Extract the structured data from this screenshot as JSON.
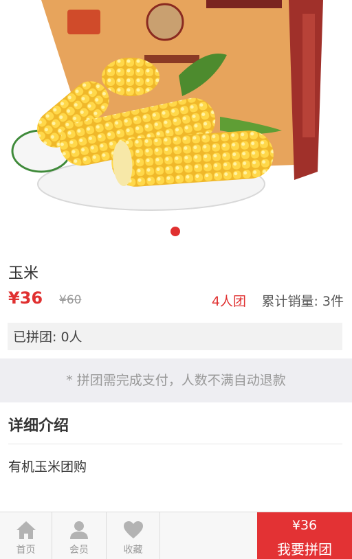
{
  "product": {
    "image_alt": "玉米",
    "slides_total": 1,
    "current_slide": 1,
    "title": "玉米",
    "price": "¥36",
    "original_price": "¥60",
    "group_size": "4人团",
    "sold_label": "累计销量: 3件"
  },
  "joined_label": "已拼团: 0人",
  "notice": "* 拼团需完成支付，人数不满自动退款",
  "detail": {
    "heading": "详细介绍",
    "body": "有机玉米团购"
  },
  "tabbar": {
    "home": {
      "label": "首页",
      "icon": "home-icon"
    },
    "member": {
      "label": "会员",
      "icon": "user-icon"
    },
    "favorite": {
      "label": "收藏",
      "icon": "heart-icon"
    },
    "buy": {
      "price": "¥36",
      "label": "我要拼团"
    }
  },
  "colors": {
    "accent": "#e03030",
    "buy_button": "#e33234",
    "notice_bg": "#eeeef2"
  }
}
